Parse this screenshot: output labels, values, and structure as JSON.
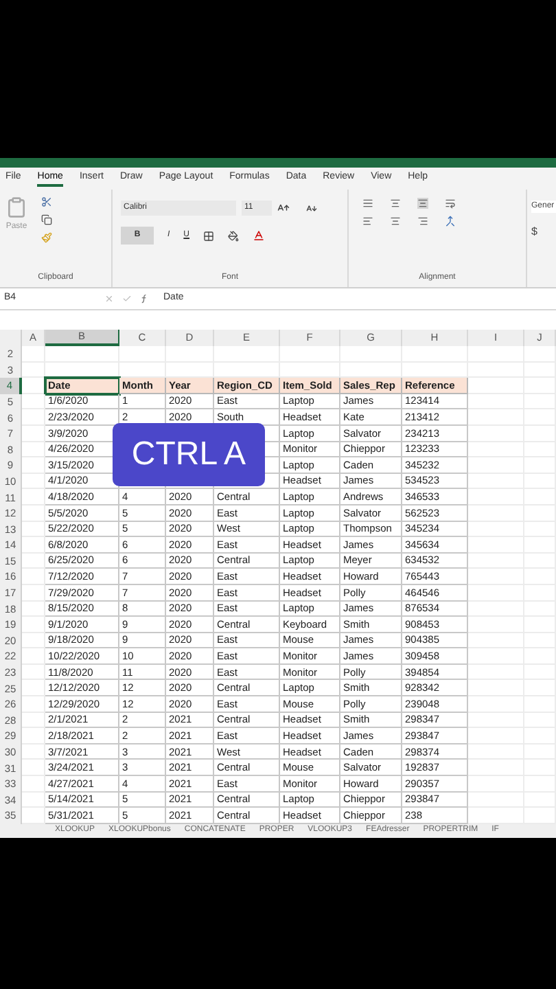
{
  "ribbon_tabs": [
    {
      "label": "File",
      "selected": false
    },
    {
      "label": "Home",
      "selected": true
    },
    {
      "label": "Insert",
      "selected": false
    },
    {
      "label": "Draw",
      "selected": false
    },
    {
      "label": "Page Layout",
      "selected": false
    },
    {
      "label": "Formulas",
      "selected": false
    },
    {
      "label": "Data",
      "selected": false
    },
    {
      "label": "Review",
      "selected": false
    },
    {
      "label": "View",
      "selected": false
    },
    {
      "label": "Help",
      "selected": false
    }
  ],
  "clipboard": {
    "paste_label": "Paste",
    "group_label": "Clipboard"
  },
  "font": {
    "name": "Calibri",
    "size": "11",
    "bold": true,
    "bold_label": "B",
    "italic_label": "I",
    "underline_label": "U",
    "group_label": "Font"
  },
  "alignment": {
    "group_label": "Alignment"
  },
  "number": {
    "format": "Gener",
    "currency": "$"
  },
  "formula_bar": {
    "name_box": "B4",
    "value": "Date"
  },
  "columns": [
    {
      "label": "A",
      "selected": false
    },
    {
      "label": "B",
      "selected": true
    },
    {
      "label": "C",
      "selected": false
    },
    {
      "label": "D",
      "selected": false
    },
    {
      "label": "E",
      "selected": false
    },
    {
      "label": "F",
      "selected": false
    },
    {
      "label": "G",
      "selected": false
    },
    {
      "label": "H",
      "selected": false
    },
    {
      "label": "I",
      "selected": false
    },
    {
      "label": "J",
      "selected": false
    }
  ],
  "rows": [
    {
      "number": "2",
      "kind": "blank",
      "selected": false
    },
    {
      "number": "3",
      "kind": "blank",
      "selected": false
    },
    {
      "number": "4",
      "kind": "header",
      "selected": true,
      "cells": [
        "Date",
        "Month",
        "Year",
        "Region_CD",
        "Item_Sold",
        "Sales_Rep",
        "Reference"
      ]
    },
    {
      "number": "5",
      "kind": "data",
      "selected": false,
      "cells": [
        "1/6/2020",
        "1",
        "2020",
        "East",
        "Laptop",
        "James",
        "123414"
      ]
    },
    {
      "number": "6",
      "kind": "data",
      "selected": false,
      "cells": [
        "2/23/2020",
        "2",
        "2020",
        "South",
        "Headset",
        "Kate",
        "213412"
      ]
    },
    {
      "number": "7",
      "kind": "data",
      "selected": false,
      "cells": [
        "3/9/2020",
        null,
        null,
        null,
        "Laptop",
        "Salvator",
        "234213"
      ]
    },
    {
      "number": "8",
      "kind": "data",
      "selected": false,
      "cells": [
        "4/26/2020",
        null,
        null,
        null,
        "Monitor",
        "Chieppor",
        "123233"
      ]
    },
    {
      "number": "9",
      "kind": "data",
      "selected": false,
      "cells": [
        "3/15/2020",
        null,
        null,
        null,
        "Laptop",
        "Caden",
        "345232"
      ]
    },
    {
      "number": "10",
      "kind": "data",
      "selected": false,
      "cells": [
        "4/1/2020",
        null,
        null,
        null,
        "Headset",
        "James",
        "534523"
      ]
    },
    {
      "number": "11",
      "kind": "data",
      "selected": false,
      "cells": [
        "4/18/2020",
        "4",
        "2020",
        "Central",
        "Laptop",
        "Andrews",
        "346533"
      ]
    },
    {
      "number": "12",
      "kind": "data",
      "selected": false,
      "cells": [
        "5/5/2020",
        "5",
        "2020",
        "East",
        "Laptop",
        "Salvator",
        "562523"
      ]
    },
    {
      "number": "13",
      "kind": "data",
      "selected": false,
      "cells": [
        "5/22/2020",
        "5",
        "2020",
        "West",
        "Laptop",
        "Thompson",
        "345234"
      ]
    },
    {
      "number": "14",
      "kind": "data",
      "selected": false,
      "cells": [
        "6/8/2020",
        "6",
        "2020",
        "East",
        "Headset",
        "James",
        "345634"
      ]
    },
    {
      "number": "15",
      "kind": "data",
      "selected": false,
      "cells": [
        "6/25/2020",
        "6",
        "2020",
        "Central",
        "Laptop",
        "Meyer",
        "634532"
      ]
    },
    {
      "number": "16",
      "kind": "data",
      "selected": false,
      "cells": [
        "7/12/2020",
        "7",
        "2020",
        "East",
        "Headset",
        "Howard",
        "765443"
      ]
    },
    {
      "number": "17",
      "kind": "data",
      "selected": false,
      "cells": [
        "7/29/2020",
        "7",
        "2020",
        "East",
        "Headset",
        "Polly",
        "464546"
      ]
    },
    {
      "number": "18",
      "kind": "data",
      "selected": false,
      "cells": [
        "8/15/2020",
        "8",
        "2020",
        "East",
        "Laptop",
        "James",
        "876534"
      ]
    },
    {
      "number": "19",
      "kind": "data",
      "selected": false,
      "cells": [
        "9/1/2020",
        "9",
        "2020",
        "Central",
        "Keyboard",
        "Smith",
        "908453"
      ]
    },
    {
      "number": "20",
      "kind": "data",
      "selected": false,
      "cells": [
        "9/18/2020",
        "9",
        "2020",
        "East",
        "Mouse",
        "James",
        "904385"
      ]
    },
    {
      "number": "22",
      "kind": "data",
      "selected": false,
      "cells": [
        "10/22/2020",
        "10",
        "2020",
        "East",
        "Monitor",
        "James",
        "309458"
      ]
    },
    {
      "number": "23",
      "kind": "data",
      "selected": false,
      "cells": [
        "11/8/2020",
        "11",
        "2020",
        "East",
        "Monitor",
        "Polly",
        "394854"
      ]
    },
    {
      "number": "25",
      "kind": "data",
      "selected": false,
      "cells": [
        "12/12/2020",
        "12",
        "2020",
        "Central",
        "Laptop",
        "Smith",
        "928342"
      ]
    },
    {
      "number": "26",
      "kind": "data",
      "selected": false,
      "cells": [
        "12/29/2020",
        "12",
        "2020",
        "East",
        "Mouse",
        "Polly",
        "239048"
      ]
    },
    {
      "number": "28",
      "kind": "data",
      "selected": false,
      "cells": [
        "2/1/2021",
        "2",
        "2021",
        "Central",
        "Headset",
        "Smith",
        "298347"
      ]
    },
    {
      "number": "29",
      "kind": "data",
      "selected": false,
      "cells": [
        "2/18/2021",
        "2",
        "2021",
        "East",
        "Headset",
        "James",
        "293847"
      ]
    },
    {
      "number": "30",
      "kind": "data",
      "selected": false,
      "cells": [
        "3/7/2021",
        "3",
        "2021",
        "West",
        "Headset",
        "Caden",
        "298374"
      ]
    },
    {
      "number": "31",
      "kind": "data",
      "selected": false,
      "cells": [
        "3/24/2021",
        "3",
        "2021",
        "Central",
        "Mouse",
        "Salvator",
        "192837"
      ]
    },
    {
      "number": "33",
      "kind": "data",
      "selected": false,
      "cells": [
        "4/27/2021",
        "4",
        "2021",
        "East",
        "Monitor",
        "Howard",
        "290357"
      ]
    },
    {
      "number": "34",
      "kind": "data",
      "selected": false,
      "cells": [
        "5/14/2021",
        "5",
        "2021",
        "Central",
        "Laptop",
        "Chieppor",
        "293847"
      ]
    },
    {
      "number": "35",
      "kind": "data",
      "selected": false,
      "cells": [
        "5/31/2021",
        "5",
        "2021",
        "Central",
        "Headset",
        "Chieppor",
        "238"
      ]
    }
  ],
  "overlay": {
    "text": "CTRL A"
  },
  "sheet_tabs": [
    "XLOOKUP",
    "XLOOKUPbonus",
    "CONCATENATE",
    "PROPER",
    "VLOOKUP3",
    "FEAdresser",
    "PROPERTRIM",
    "IF"
  ]
}
